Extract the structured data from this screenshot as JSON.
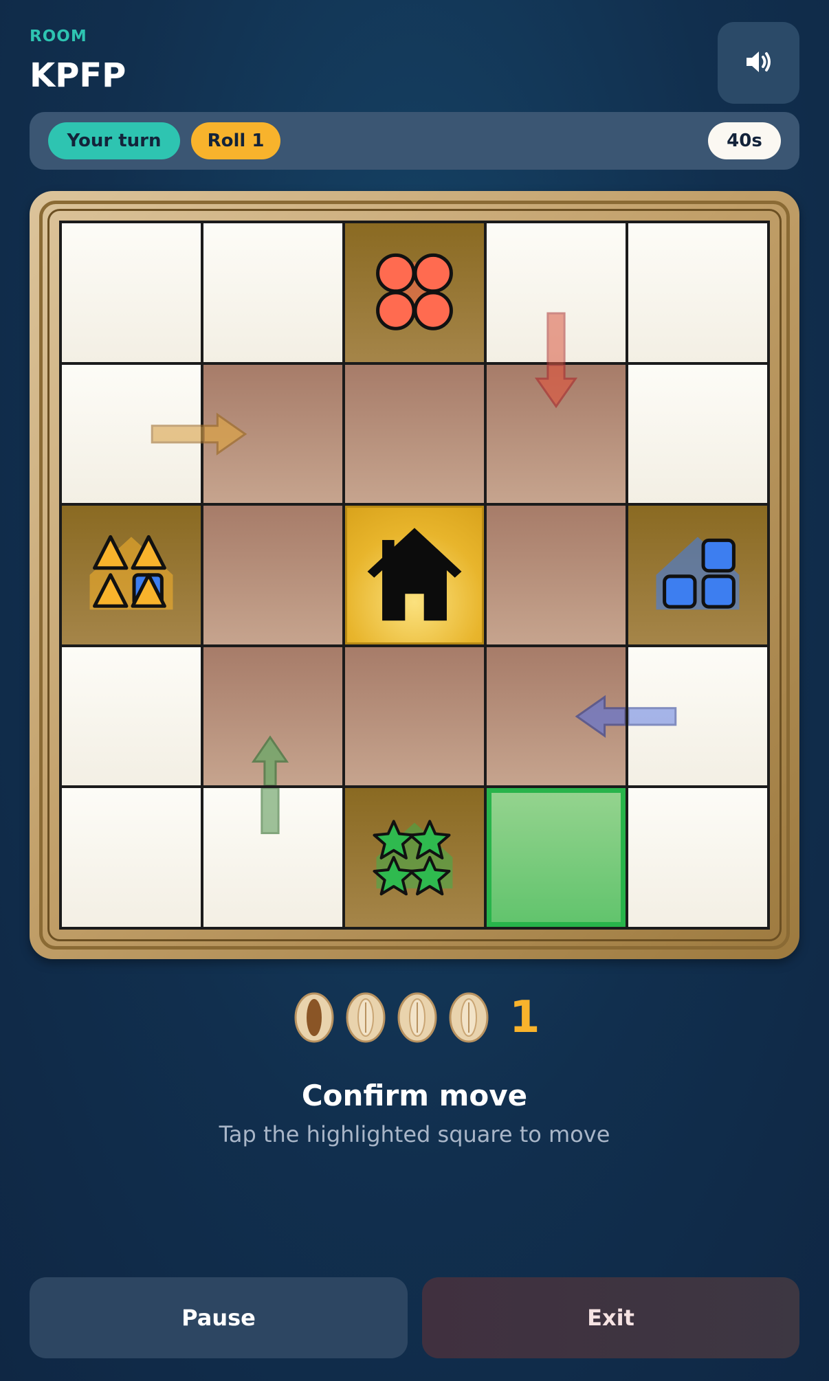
{
  "header": {
    "room_label": "ROOM",
    "room_code": "KPFP",
    "sound_icon": "speaker-icon"
  },
  "status": {
    "turn_label": "Your turn",
    "roll_label": "Roll 1",
    "timer": "40s"
  },
  "board": {
    "rows": 5,
    "cols": 5,
    "home_icon": "house-icon",
    "players": [
      {
        "color": "#ff6b50",
        "shape": "circle",
        "pieces": 4,
        "cell": "r0c2"
      },
      {
        "color": "#f8b32c",
        "shape": "triangle",
        "pieces": 4,
        "cell": "r2c0"
      },
      {
        "color": "#3d7ef0",
        "shape": "square",
        "pieces": 4,
        "cell": "r2c4"
      },
      {
        "color": "#2fba4f",
        "shape": "star",
        "pieces": 4,
        "cell": "r4c2"
      }
    ],
    "highlighted_cell": "r4c3"
  },
  "dice": {
    "shells": [
      "down",
      "up",
      "up",
      "up"
    ],
    "value": "1"
  },
  "message": {
    "title": "Confirm move",
    "subtitle": "Tap the highlighted square to move"
  },
  "buttons": {
    "pause": "Pause",
    "exit": "Exit"
  },
  "colors": {
    "accent_teal": "#2ec4b1",
    "accent_orange": "#f8b32c",
    "highlight_green": "#28b44b"
  }
}
